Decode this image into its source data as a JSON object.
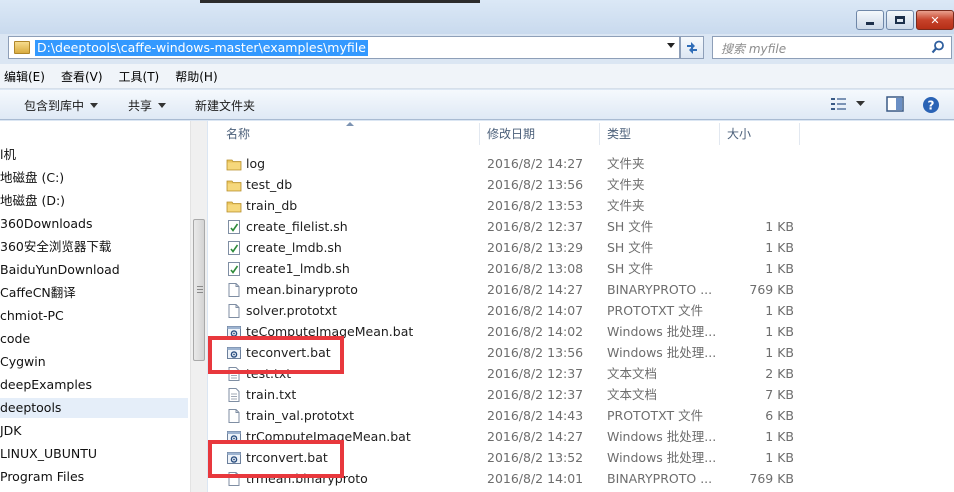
{
  "address": {
    "path": "D:\\deeptools\\caffe-windows-master\\examples\\myfile"
  },
  "search": {
    "placeholder": "搜索 myfile"
  },
  "menu": [
    "编辑(E)",
    "查看(V)",
    "工具(T)",
    "帮助(H)"
  ],
  "toolbar": {
    "include_label": "包含到库中",
    "share_label": "共享",
    "new_folder_label": "新建文件夹"
  },
  "nav": {
    "items": [
      {
        "label": "l机"
      },
      {
        "label": "地磁盘 (C:)"
      },
      {
        "label": "地磁盘 (D:)"
      },
      {
        "label": "360Downloads"
      },
      {
        "label": "360安全浏览器下载"
      },
      {
        "label": "BaiduYunDownload"
      },
      {
        "label": "CaffeCN翻译"
      },
      {
        "label": "chmiot-PC"
      },
      {
        "label": "code"
      },
      {
        "label": "Cygwin"
      },
      {
        "label": "deepExamples"
      },
      {
        "label": "deeptools"
      },
      {
        "label": "JDK"
      },
      {
        "label": "LINUX_UBUNTU"
      },
      {
        "label": "Program Files"
      }
    ],
    "selected_index": 11
  },
  "columns": {
    "name": "名称",
    "date": "修改日期",
    "type": "类型",
    "size": "大小"
  },
  "files": [
    {
      "name": "log",
      "date": "2016/8/2 14:27",
      "type": "文件夹",
      "size": "",
      "icon": "folder"
    },
    {
      "name": "test_db",
      "date": "2016/8/2 13:56",
      "type": "文件夹",
      "size": "",
      "icon": "folder"
    },
    {
      "name": "train_db",
      "date": "2016/8/2 13:53",
      "type": "文件夹",
      "size": "",
      "icon": "folder"
    },
    {
      "name": "create_filelist.sh",
      "date": "2016/8/2 12:37",
      "type": "SH 文件",
      "size": "1 KB",
      "icon": "sh"
    },
    {
      "name": "create_lmdb.sh",
      "date": "2016/8/2 13:29",
      "type": "SH 文件",
      "size": "1 KB",
      "icon": "sh"
    },
    {
      "name": "create1_lmdb.sh",
      "date": "2016/8/2 13:08",
      "type": "SH 文件",
      "size": "1 KB",
      "icon": "sh"
    },
    {
      "name": "mean.binaryproto",
      "date": "2016/8/2 14:27",
      "type": "BINARYPROTO ...",
      "size": "769 KB",
      "icon": "doc"
    },
    {
      "name": "solver.prototxt",
      "date": "2016/8/2 14:07",
      "type": "PROTOTXT 文件",
      "size": "1 KB",
      "icon": "doc"
    },
    {
      "name": "teComputeImageMean.bat",
      "date": "2016/8/2 14:02",
      "type": "Windows 批处理...",
      "size": "1 KB",
      "icon": "bat"
    },
    {
      "name": "teconvert.bat",
      "date": "2016/8/2 13:56",
      "type": "Windows 批处理...",
      "size": "1 KB",
      "icon": "bat"
    },
    {
      "name": "test.txt",
      "date": "2016/8/2 12:37",
      "type": "文本文档",
      "size": "2 KB",
      "icon": "txt"
    },
    {
      "name": "train.txt",
      "date": "2016/8/2 12:37",
      "type": "文本文档",
      "size": "7 KB",
      "icon": "txt"
    },
    {
      "name": "train_val.prototxt",
      "date": "2016/8/2 14:43",
      "type": "PROTOTXT 文件",
      "size": "6 KB",
      "icon": "doc"
    },
    {
      "name": "trComputeImageMean.bat",
      "date": "2016/8/2 14:27",
      "type": "Windows 批处理...",
      "size": "1 KB",
      "icon": "bat"
    },
    {
      "name": "trconvert.bat",
      "date": "2016/8/2 13:52",
      "type": "Windows 批处理...",
      "size": "1 KB",
      "icon": "bat"
    },
    {
      "name": "trmean.binaryproto",
      "date": "2016/8/2 14:01",
      "type": "BINARYPROTO ...",
      "size": "769 KB",
      "icon": "doc"
    }
  ],
  "highlight_color": "#e8383d",
  "selection_color": "#3399ff"
}
